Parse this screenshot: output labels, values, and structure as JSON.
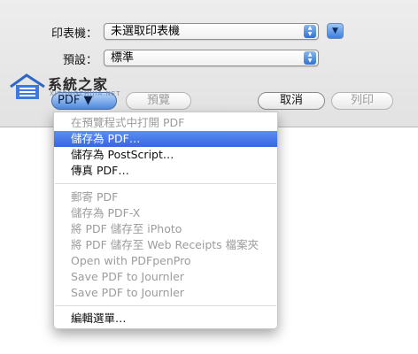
{
  "dialog": {
    "printer_label": "印表機：",
    "printer_value": "未選取印表機",
    "preset_label": "預設：",
    "preset_value": "標準",
    "pdf_button": "PDF ▼",
    "preview_button": "預覽",
    "cancel_button": "取消",
    "print_button": "列印",
    "disclosure_icon": "triangle-down-icon",
    "stepper_icon": "up-down-arrows-icon"
  },
  "watermark": {
    "title": "系統之家",
    "subtitle": "XITONGZHIJIA.NET"
  },
  "pdf_menu": {
    "items": [
      {
        "label": "在預覽程式中打開 PDF",
        "enabled": false,
        "selected": false
      },
      {
        "label": "儲存為 PDF…",
        "enabled": true,
        "selected": true
      },
      {
        "label": "儲存為 PostScript…",
        "enabled": true,
        "selected": false
      },
      {
        "label": "傳真 PDF…",
        "enabled": true,
        "selected": false
      },
      {
        "label": "郵寄 PDF",
        "enabled": false,
        "selected": false
      },
      {
        "label": "儲存為 PDF-X",
        "enabled": false,
        "selected": false
      },
      {
        "label": "將 PDF 儲存至 iPhoto",
        "enabled": false,
        "selected": false
      },
      {
        "label": "將 PDF 儲存至 Web Receipts 檔案夾",
        "enabled": false,
        "selected": false
      },
      {
        "label": "Open with PDFpenPro",
        "enabled": false,
        "selected": false
      },
      {
        "label": "Save PDF to Journler",
        "enabled": false,
        "selected": false
      },
      {
        "label": "Save PDF to Journler",
        "enabled": false,
        "selected": false
      },
      {
        "label": "編輯選單…",
        "enabled": true,
        "selected": false
      }
    ]
  },
  "colors": {
    "selection": "#3566e0",
    "accent_blue": "#4f8be0",
    "disabled_text": "#9c9c9c"
  }
}
